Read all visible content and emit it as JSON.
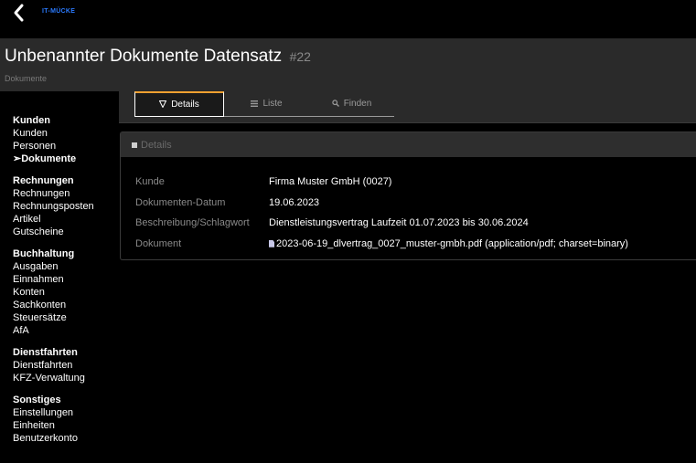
{
  "topbar": {
    "brand": "IT-MÜCKE"
  },
  "header": {
    "title": "Unbenannter Dokumente Datensatz",
    "record_id": "#22",
    "breadcrumb": "Dokumente"
  },
  "sidebar": {
    "groups": [
      {
        "heading": "Kunden",
        "items": [
          "Kunden",
          "Personen",
          "➢Dokumente"
        ]
      },
      {
        "heading": "Rechnungen",
        "items": [
          "Rechnungen",
          "Rechnungsposten",
          "Artikel",
          "Gutscheine"
        ]
      },
      {
        "heading": "Buchhaltung",
        "items": [
          "Ausgaben",
          "Einnahmen",
          "Konten",
          "Sachkonten",
          "Steuersätze",
          "AfA"
        ]
      },
      {
        "heading": "Dienstfahrten",
        "items": [
          "Dienstfahrten",
          "KFZ-Verwaltung"
        ]
      },
      {
        "heading": "Sonstiges",
        "items": [
          "Einstellungen",
          "Einheiten",
          "Benutzerkonto"
        ]
      }
    ],
    "active_item": "➢Dokumente"
  },
  "tabs": [
    {
      "label": "Details",
      "icon": "filter-icon",
      "active": true
    },
    {
      "label": "Liste",
      "icon": "list-icon",
      "active": false
    },
    {
      "label": "Finden",
      "icon": "search-icon",
      "active": false
    }
  ],
  "panel": {
    "title": "Details",
    "fields": {
      "kunde": {
        "label": "Kunde",
        "value": "Firma Muster GmbH (0027)"
      },
      "datum": {
        "label": "Dokumenten-Datum",
        "value": "19.06.2023"
      },
      "beschreibung": {
        "label": "Beschreibung/Schlagwort",
        "value": "Dienstleistungsvertrag Laufzeit 01.07.2023 bis 30.06.2024"
      },
      "dokument": {
        "label": "Dokument",
        "filename": "2023-06-19_dlvertrag_0027_muster-gmbh.pdf",
        "mimetype": "(application/pdf; charset=binary)"
      }
    }
  },
  "colors": {
    "accent_tab": "#f0a030",
    "brand": "#2b7bff",
    "header_bg": "#2a2a2a"
  }
}
